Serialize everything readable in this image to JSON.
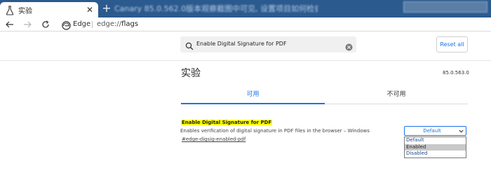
{
  "tabstrip": {
    "tab_title": "实验",
    "background_text": "Canary 85.0.562.0版本观察截图中可见, 设置项目如何检查"
  },
  "toolbar": {
    "site_name": "Edge",
    "url_scheme": "edge://",
    "url_path": "flags"
  },
  "flags": {
    "search_value": "Enable Digital Signature for PDF",
    "reset_label": "Reset all",
    "title": "实验",
    "version": "85.0.563.0",
    "tabs": [
      {
        "label": "可用"
      },
      {
        "label": "不可用"
      }
    ],
    "experiment": {
      "name": "Enable Digital Signature for PDF",
      "description": "Enables verification of digital signature in PDF files in the browser – Windows",
      "link": "#edge-digsig-enabled-pdf",
      "selected": "Default",
      "options": [
        "Default",
        "Enabled",
        "Disabled"
      ],
      "highlighted_option": "Enabled"
    }
  },
  "colors": {
    "accent": "#1a73e8",
    "highlight": "#ffff00",
    "tabstrip": "#2b5a8e"
  },
  "icons": [
    "flask-icon",
    "close-icon",
    "plus-icon",
    "back-arrow-icon",
    "forward-arrow-icon",
    "reload-icon",
    "edge-logo-icon",
    "search-icon",
    "clear-icon",
    "chevron-down-icon"
  ]
}
